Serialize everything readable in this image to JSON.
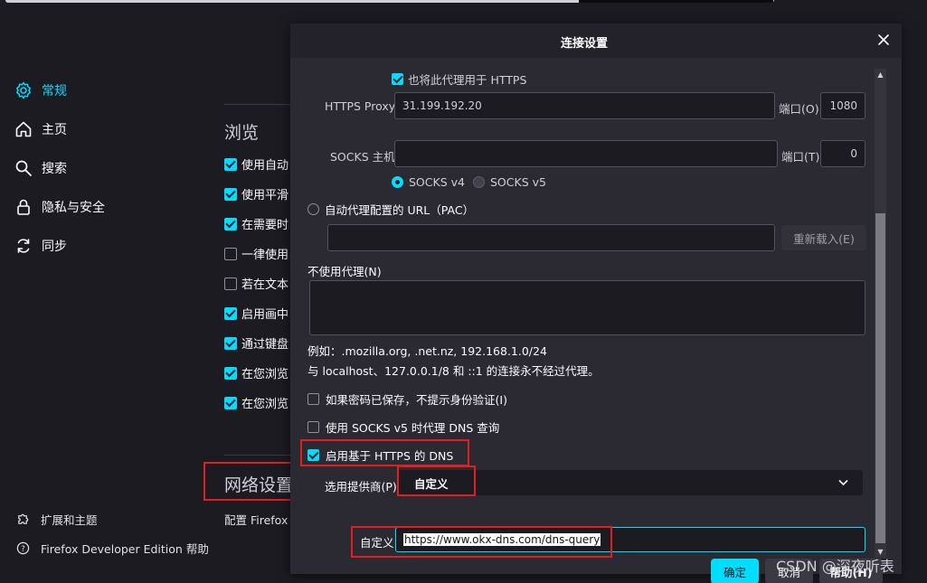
{
  "sidebar": {
    "items": [
      {
        "label": "常规",
        "icon": "gear-icon",
        "active": true
      },
      {
        "label": "主页",
        "icon": "home-icon"
      },
      {
        "label": "搜索",
        "icon": "search-icon"
      },
      {
        "label": "隐私与安全",
        "icon": "lock-icon"
      },
      {
        "label": "同步",
        "icon": "sync-icon"
      }
    ],
    "bottom": [
      {
        "label": "扩展和主题",
        "icon": "puzzle-icon"
      },
      {
        "label": "Firefox Developer Edition 帮助",
        "icon": "help-icon"
      }
    ]
  },
  "browsing": {
    "title": "浏览",
    "rows": [
      {
        "label": "使用自动",
        "checked": true
      },
      {
        "label": "使用平滑",
        "checked": true
      },
      {
        "label": "在需要时",
        "checked": true
      },
      {
        "label": "一律使用",
        "checked": false
      },
      {
        "label": "若在文本",
        "checked": false
      },
      {
        "label": "启用画中",
        "checked": true
      },
      {
        "label": "通过键盘",
        "checked": true
      },
      {
        "label": "在您浏览",
        "checked": true
      },
      {
        "label": "在您浏览",
        "checked": true
      }
    ]
  },
  "network": {
    "title": "网络设置",
    "subtitle": "配置 Firefox"
  },
  "dialog": {
    "title": "连接设置",
    "https_also": "也将此代理用于 HTTPS",
    "https_proxy_label": "HTTPS Proxy",
    "https_proxy_value": "31.199.192.20",
    "port_label": "端口(O)",
    "https_port_value": "1080",
    "socks_host_label": "SOCKS 主机",
    "socks_host_value": "",
    "socks_port_label": "端口(T)",
    "socks_port_value": "0",
    "socks_v4": "SOCKS v4",
    "socks_v5": "SOCKS v5",
    "auto_proxy_label": "自动代理配置的 URL（PAC）",
    "reload_button": "重新载入(E)",
    "no_proxy_label": "不使用代理(N)",
    "no_proxy_value": "",
    "example_text": "例如：.mozilla.org, .net.nz, 192.168.1.0/24",
    "localhost_text": "与 localhost、127.0.0.1/8 和 ::1 的连接永不经过代理。",
    "no_auth_prompt": "如果密码已保存，不提示身份验证(I)",
    "socks_dns": "使用 SOCKS v5 时代理 DNS 查询",
    "doh_enable": "启用基于 HTTPS 的 DNS",
    "provider_label": "选用提供商(P)",
    "provider_value": "自定义",
    "custom_label": "自定义",
    "custom_url": "https://www.okx-dns.com/dns-query",
    "ok_button": "确定",
    "cancel_button": "取消",
    "help_button": "帮助(H)"
  },
  "watermark": "CSDN @深夜听表",
  "colors": {
    "accent": "#00ddff",
    "highlight_box": "#e0201f"
  }
}
